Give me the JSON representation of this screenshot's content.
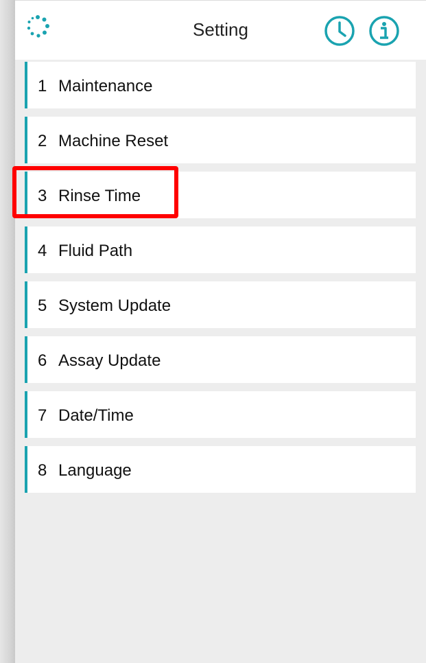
{
  "header": {
    "title": "Setting",
    "logo_icon": "spinner-ring-icon",
    "clock_icon": "clock-icon",
    "info_icon": "info-icon",
    "accent_color": "#1aa3b0"
  },
  "menu": {
    "items": [
      {
        "number": "1",
        "label": "Maintenance"
      },
      {
        "number": "2",
        "label": "Machine Reset"
      },
      {
        "number": "3",
        "label": "Rinse Time"
      },
      {
        "number": "4",
        "label": "Fluid Path"
      },
      {
        "number": "5",
        "label": "System Update"
      },
      {
        "number": "6",
        "label": "Assay Update"
      },
      {
        "number": "7",
        "label": "Date/Time"
      },
      {
        "number": "8",
        "label": "Language"
      }
    ],
    "highlighted_item": "3",
    "highlight_color": "#ff0000"
  }
}
